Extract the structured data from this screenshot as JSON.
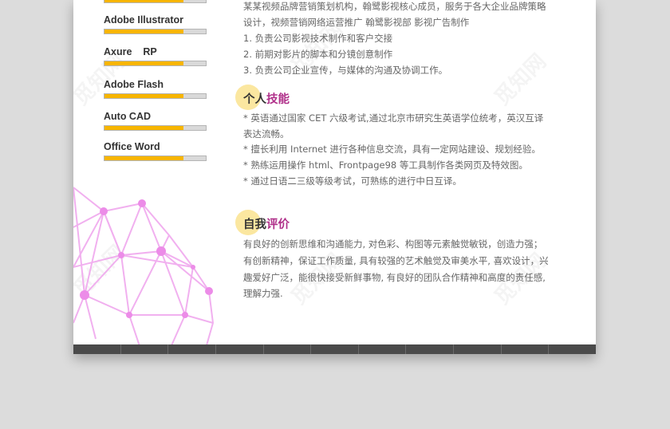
{
  "skills": [
    {
      "name": "",
      "level": 0.78
    },
    {
      "name": "Adobe Illustrator",
      "level": 0.78
    },
    {
      "name": "Axure    RP",
      "level": 0.78
    },
    {
      "name": "Adobe Flash",
      "level": 0.78
    },
    {
      "name": "Auto CAD",
      "level": 0.78
    },
    {
      "name": "Office Word",
      "level": 0.78
    }
  ],
  "experience": {
    "intro_line1": "某某视频品牌营销策划机构，翰鹭影视核心成员，服务于各大企业品牌策略",
    "intro_line2": "设计，视频营销网络运营推广  翰鹭影视部  影视广告制作",
    "items": [
      "1.  负责公司影视技术制作和客户交接",
      "2.  前期对影片的脚本和分镜创意制作",
      "3.  负责公司企业宣传，与媒体的沟通及协调工作。"
    ]
  },
  "skills_section": {
    "heading_a": "个人",
    "heading_b": "技能",
    "lines": [
      "*  英语通过国家 CET 六级考试,通过北京市研究生英语学位统考，英汉互译",
      "表达流畅。",
      "*  擅长利用 Internet 进行各种信息交流，具有一定网站建设、规划经验。",
      "*  熟练运用操作 html、Frontpage98 等工具制作各类网页及特效图。",
      "*  通过日语二三级等级考试，可熟练的进行中日互译。"
    ]
  },
  "evaluation": {
    "heading_a": "自我",
    "heading_b": "评价",
    "lines": [
      "有良好的创新思维和沟通能力, 对色彩、构图等元素触觉敏锐，创造力强；",
      "有创新精神，保证工作质量, 具有较强的艺术触觉及审美水平, 喜欢设计，兴",
      "趣爱好广泛，能很快接受新鲜事物, 有良好的团队合作精神和高度的责任感,",
      "理解力强."
    ]
  },
  "watermark": "觅知网",
  "colors": {
    "accent_yellow": "#f7b500",
    "heading_purple": "#b0308a",
    "heading_circle": "#fbe7a0",
    "footer": "#4a4a4a"
  }
}
